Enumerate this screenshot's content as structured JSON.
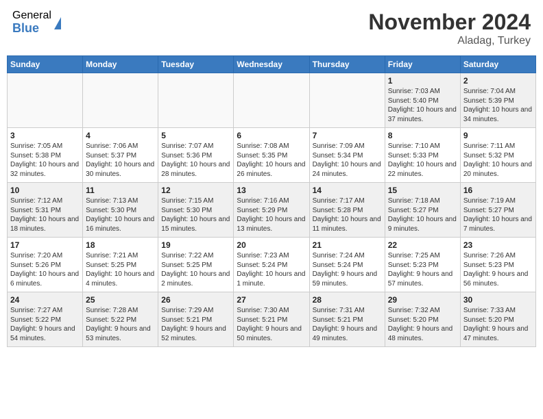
{
  "header": {
    "logo_general": "General",
    "logo_blue": "Blue",
    "month_title": "November 2024",
    "location": "Aladag, Turkey"
  },
  "days_of_week": [
    "Sunday",
    "Monday",
    "Tuesday",
    "Wednesday",
    "Thursday",
    "Friday",
    "Saturday"
  ],
  "weeks": [
    [
      {
        "num": "",
        "info": ""
      },
      {
        "num": "",
        "info": ""
      },
      {
        "num": "",
        "info": ""
      },
      {
        "num": "",
        "info": ""
      },
      {
        "num": "",
        "info": ""
      },
      {
        "num": "1",
        "info": "Sunrise: 7:03 AM\nSunset: 5:40 PM\nDaylight: 10 hours and 37 minutes."
      },
      {
        "num": "2",
        "info": "Sunrise: 7:04 AM\nSunset: 5:39 PM\nDaylight: 10 hours and 34 minutes."
      }
    ],
    [
      {
        "num": "3",
        "info": "Sunrise: 7:05 AM\nSunset: 5:38 PM\nDaylight: 10 hours and 32 minutes."
      },
      {
        "num": "4",
        "info": "Sunrise: 7:06 AM\nSunset: 5:37 PM\nDaylight: 10 hours and 30 minutes."
      },
      {
        "num": "5",
        "info": "Sunrise: 7:07 AM\nSunset: 5:36 PM\nDaylight: 10 hours and 28 minutes."
      },
      {
        "num": "6",
        "info": "Sunrise: 7:08 AM\nSunset: 5:35 PM\nDaylight: 10 hours and 26 minutes."
      },
      {
        "num": "7",
        "info": "Sunrise: 7:09 AM\nSunset: 5:34 PM\nDaylight: 10 hours and 24 minutes."
      },
      {
        "num": "8",
        "info": "Sunrise: 7:10 AM\nSunset: 5:33 PM\nDaylight: 10 hours and 22 minutes."
      },
      {
        "num": "9",
        "info": "Sunrise: 7:11 AM\nSunset: 5:32 PM\nDaylight: 10 hours and 20 minutes."
      }
    ],
    [
      {
        "num": "10",
        "info": "Sunrise: 7:12 AM\nSunset: 5:31 PM\nDaylight: 10 hours and 18 minutes."
      },
      {
        "num": "11",
        "info": "Sunrise: 7:13 AM\nSunset: 5:30 PM\nDaylight: 10 hours and 16 minutes."
      },
      {
        "num": "12",
        "info": "Sunrise: 7:15 AM\nSunset: 5:30 PM\nDaylight: 10 hours and 15 minutes."
      },
      {
        "num": "13",
        "info": "Sunrise: 7:16 AM\nSunset: 5:29 PM\nDaylight: 10 hours and 13 minutes."
      },
      {
        "num": "14",
        "info": "Sunrise: 7:17 AM\nSunset: 5:28 PM\nDaylight: 10 hours and 11 minutes."
      },
      {
        "num": "15",
        "info": "Sunrise: 7:18 AM\nSunset: 5:27 PM\nDaylight: 10 hours and 9 minutes."
      },
      {
        "num": "16",
        "info": "Sunrise: 7:19 AM\nSunset: 5:27 PM\nDaylight: 10 hours and 7 minutes."
      }
    ],
    [
      {
        "num": "17",
        "info": "Sunrise: 7:20 AM\nSunset: 5:26 PM\nDaylight: 10 hours and 6 minutes."
      },
      {
        "num": "18",
        "info": "Sunrise: 7:21 AM\nSunset: 5:25 PM\nDaylight: 10 hours and 4 minutes."
      },
      {
        "num": "19",
        "info": "Sunrise: 7:22 AM\nSunset: 5:25 PM\nDaylight: 10 hours and 2 minutes."
      },
      {
        "num": "20",
        "info": "Sunrise: 7:23 AM\nSunset: 5:24 PM\nDaylight: 10 hours and 1 minute."
      },
      {
        "num": "21",
        "info": "Sunrise: 7:24 AM\nSunset: 5:24 PM\nDaylight: 9 hours and 59 minutes."
      },
      {
        "num": "22",
        "info": "Sunrise: 7:25 AM\nSunset: 5:23 PM\nDaylight: 9 hours and 57 minutes."
      },
      {
        "num": "23",
        "info": "Sunrise: 7:26 AM\nSunset: 5:23 PM\nDaylight: 9 hours and 56 minutes."
      }
    ],
    [
      {
        "num": "24",
        "info": "Sunrise: 7:27 AM\nSunset: 5:22 PM\nDaylight: 9 hours and 54 minutes."
      },
      {
        "num": "25",
        "info": "Sunrise: 7:28 AM\nSunset: 5:22 PM\nDaylight: 9 hours and 53 minutes."
      },
      {
        "num": "26",
        "info": "Sunrise: 7:29 AM\nSunset: 5:21 PM\nDaylight: 9 hours and 52 minutes."
      },
      {
        "num": "27",
        "info": "Sunrise: 7:30 AM\nSunset: 5:21 PM\nDaylight: 9 hours and 50 minutes."
      },
      {
        "num": "28",
        "info": "Sunrise: 7:31 AM\nSunset: 5:21 PM\nDaylight: 9 hours and 49 minutes."
      },
      {
        "num": "29",
        "info": "Sunrise: 7:32 AM\nSunset: 5:20 PM\nDaylight: 9 hours and 48 minutes."
      },
      {
        "num": "30",
        "info": "Sunrise: 7:33 AM\nSunset: 5:20 PM\nDaylight: 9 hours and 47 minutes."
      }
    ]
  ]
}
